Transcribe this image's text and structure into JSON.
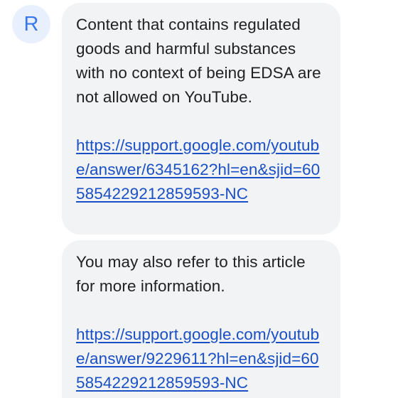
{
  "sender": {
    "avatar_letter": "R"
  },
  "messages": [
    {
      "text": "Content that contains regulated goods and harmful substances with no context of being EDSA are not allowed on YouTube.",
      "link": "https://support.google.com/youtube/answer/6345162?hl=en&sjid=605854229212859593-NC"
    },
    {
      "text": "You may also refer to this article for more information.",
      "link": "https://support.google.com/youtube/answer/9229611?hl=en&sjid=605854229212859593-NC"
    }
  ],
  "colors": {
    "bubble_background": "#f1f3f4",
    "link": "#1a4fc5",
    "avatar_background": "#e8f0fe",
    "avatar_letter": "#3b78e7",
    "text": "#202124"
  }
}
